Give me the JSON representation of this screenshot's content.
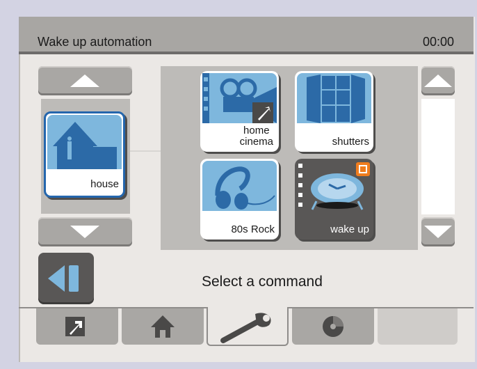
{
  "header": {
    "title": "Wake up automation",
    "clock": "00:00"
  },
  "left_panel": {
    "selected_item_label": "house"
  },
  "grid": {
    "tiles": [
      {
        "label": "home\ncinema"
      },
      {
        "label": "shutters"
      },
      {
        "label": "80s Rock"
      },
      {
        "label": "wake up"
      }
    ]
  },
  "status": {
    "message": "Select a command"
  },
  "tabs": [
    {
      "icon": "shortcut-arrow-icon"
    },
    {
      "icon": "home-icon"
    },
    {
      "icon": "wrench-icon"
    },
    {
      "icon": "disc-icon"
    },
    {
      "icon": "empty"
    }
  ],
  "colors": {
    "accent_blue": "#2466ad",
    "tile_art_blue": "#7eb7dd",
    "wakeup_badge_orange": "#f07d1e"
  }
}
